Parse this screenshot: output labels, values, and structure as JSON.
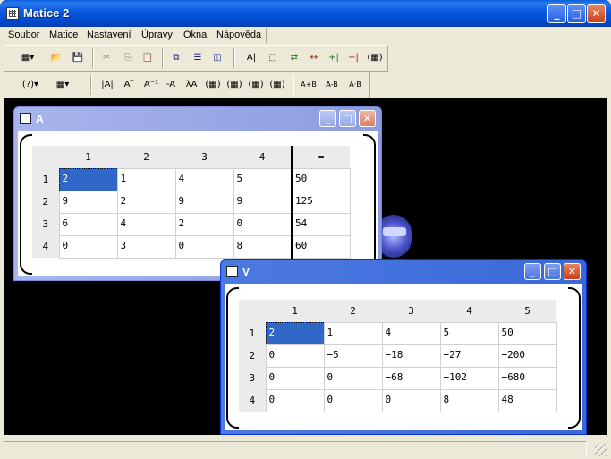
{
  "app": {
    "title": "Matice 2"
  },
  "menu": [
    {
      "label": "Soubor"
    },
    {
      "label": "Matice"
    },
    {
      "label": "Nastavení"
    },
    {
      "label": "Úpravy"
    },
    {
      "label": "Okna"
    },
    {
      "label": "Nápověda"
    }
  ],
  "toolbar1": [
    {
      "name": "matrix-dropdown-icon",
      "glyph": "▦▾"
    },
    {
      "name": "open-folder-icon",
      "glyph": "📂"
    },
    {
      "name": "save-icon",
      "glyph": "💾"
    },
    {
      "name": "cut-icon",
      "glyph": "✂"
    },
    {
      "name": "copy-icon",
      "glyph": "⎘"
    },
    {
      "name": "paste-icon",
      "glyph": "📋"
    },
    {
      "name": "cascade-icon",
      "glyph": "⧉"
    },
    {
      "name": "tile-horizontal-icon",
      "glyph": "☰"
    },
    {
      "name": "tile-vertical-icon",
      "glyph": "◫"
    },
    {
      "name": "text-cursor-icon",
      "glyph": "A|"
    },
    {
      "name": "select-rect-icon",
      "glyph": "⬚"
    },
    {
      "name": "row-swap-icon",
      "glyph": "⇄"
    },
    {
      "name": "row-op-icon",
      "glyph": "↔"
    },
    {
      "name": "insert-column-icon",
      "glyph": "+|"
    },
    {
      "name": "delete-column-icon",
      "glyph": "−|"
    },
    {
      "name": "matrix-brackets-icon",
      "glyph": "(▦)"
    }
  ],
  "toolbar2": [
    {
      "name": "determinant-dropdown-icon",
      "glyph": "(?)▾"
    },
    {
      "name": "matrix-type-dropdown-icon",
      "glyph": "▦▾"
    },
    {
      "name": "abs-a-icon",
      "glyph": "|A|"
    },
    {
      "name": "transpose-icon",
      "glyph": "Aᵀ"
    },
    {
      "name": "inverse-icon",
      "glyph": "A⁻¹"
    },
    {
      "name": "negate-icon",
      "glyph": "-A"
    },
    {
      "name": "scalar-multiply-icon",
      "glyph": "λA"
    },
    {
      "name": "matrix-op1-icon",
      "glyph": "(▦)"
    },
    {
      "name": "matrix-op2-icon",
      "glyph": "(▦)"
    },
    {
      "name": "matrix-op3-icon",
      "glyph": "(▦)"
    },
    {
      "name": "matrix-op4-icon",
      "glyph": "(▦)"
    },
    {
      "name": "add-icon",
      "glyph": "A+B"
    },
    {
      "name": "subtract-icon",
      "glyph": "A-B"
    },
    {
      "name": "multiply-icon",
      "glyph": "A·B"
    }
  ],
  "windowA": {
    "title": "A",
    "cols": [
      "1",
      "2",
      "3",
      "4",
      "="
    ],
    "rows": [
      {
        "h": "1",
        "cells": [
          "2",
          "1",
          "4",
          "5",
          "50"
        ]
      },
      {
        "h": "2",
        "cells": [
          "9",
          "2",
          "9",
          "9",
          "125"
        ]
      },
      {
        "h": "3",
        "cells": [
          "6",
          "4",
          "2",
          "0",
          "54"
        ]
      },
      {
        "h": "4",
        "cells": [
          "0",
          "3",
          "0",
          "8",
          "60"
        ]
      }
    ]
  },
  "windowV": {
    "title": "V",
    "cols": [
      "1",
      "2",
      "3",
      "4",
      "5"
    ],
    "rows": [
      {
        "h": "1",
        "cells": [
          "2",
          "1",
          "4",
          "5",
          "50"
        ]
      },
      {
        "h": "2",
        "cells": [
          "0",
          "−5",
          "−18",
          "−27",
          "−200"
        ]
      },
      {
        "h": "3",
        "cells": [
          "0",
          "0",
          "−68",
          "−102",
          "−680"
        ]
      },
      {
        "h": "4",
        "cells": [
          "0",
          "0",
          "0",
          "8",
          "48"
        ]
      }
    ]
  }
}
